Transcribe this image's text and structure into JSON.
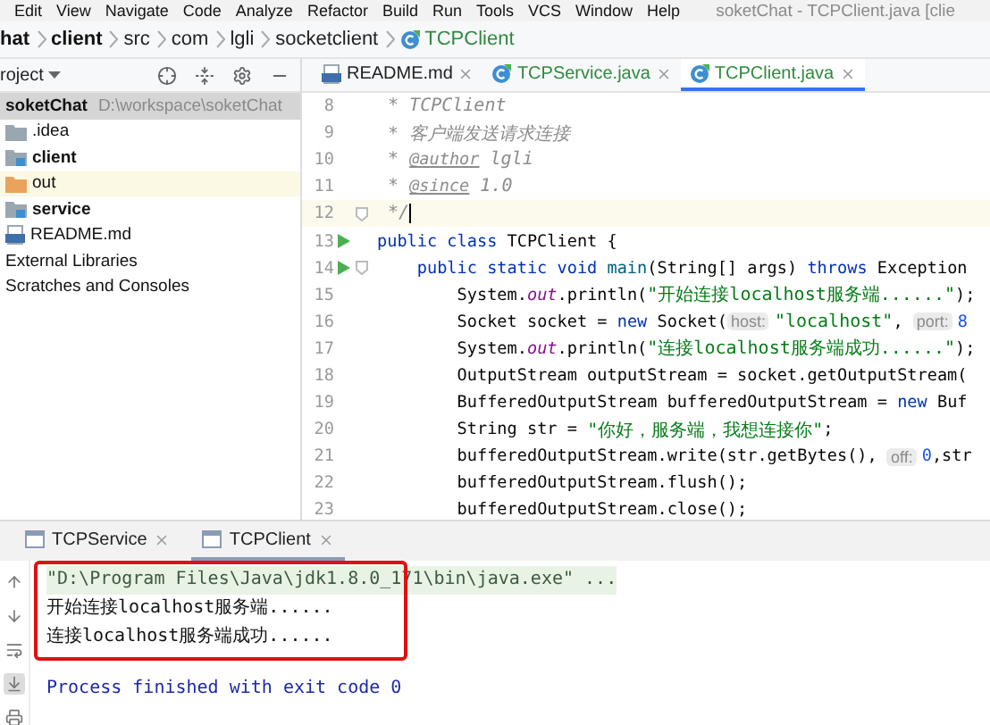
{
  "menu_bar": {
    "items": [
      "Edit",
      "View",
      "Navigate",
      "Code",
      "Analyze",
      "Refactor",
      "Build",
      "Run",
      "Tools",
      "VCS",
      "Window",
      "Help"
    ],
    "title": "soketChat - TCPClient.java [clie"
  },
  "breadcrumbs": [
    {
      "label": "hat",
      "kind": "module"
    },
    {
      "label": "client",
      "kind": "module"
    },
    {
      "label": "src",
      "kind": "folder"
    },
    {
      "label": "com",
      "kind": "folder"
    },
    {
      "label": "lgli",
      "kind": "folder"
    },
    {
      "label": "socketclient",
      "kind": "folder"
    },
    {
      "label": "TCPClient",
      "kind": "class"
    }
  ],
  "project_panel": {
    "title": "roject",
    "tree": [
      {
        "label": "soketChat",
        "path": "D:\\workspace\\soketChat",
        "kind": "project",
        "selected": true,
        "children": [
          {
            "label": ".idea",
            "kind": "folder",
            "selected": false
          },
          {
            "label": "client",
            "kind": "module",
            "selected": false
          },
          {
            "label": "out",
            "kind": "excluded",
            "selected": false
          },
          {
            "label": "service",
            "kind": "module",
            "selected": false
          },
          {
            "label": "README.md",
            "kind": "markdown",
            "selected": false
          }
        ]
      },
      {
        "label": "External Libraries",
        "kind": "library",
        "selected": false
      },
      {
        "label": "Scratches and Consoles",
        "kind": "scratches",
        "selected": false
      }
    ]
  },
  "editor": {
    "tabs": [
      {
        "label": "README.md",
        "kind": "markdown",
        "selected": false
      },
      {
        "label": "TCPService.java",
        "kind": "class",
        "selected": false
      },
      {
        "label": "TCPClient.java",
        "kind": "class",
        "selected": true
      }
    ],
    "lines": [
      {
        "number": "8",
        "run": false,
        "fold": false,
        "current": false,
        "tokens": [
          {
            "kind": "comment",
            "text": " * TCPClient"
          }
        ]
      },
      {
        "number": "9",
        "run": false,
        "fold": false,
        "current": false,
        "tokens": [
          {
            "kind": "comment",
            "text": " * 客户端发送请求连接"
          }
        ]
      },
      {
        "number": "10",
        "run": false,
        "fold": false,
        "current": false,
        "tokens": [
          {
            "kind": "comment",
            "text": " * "
          },
          {
            "kind": "doctag",
            "text": "@author"
          },
          {
            "kind": "comment",
            "text": " lgli"
          }
        ]
      },
      {
        "number": "11",
        "run": false,
        "fold": false,
        "current": false,
        "tokens": [
          {
            "kind": "comment",
            "text": " * "
          },
          {
            "kind": "doctag",
            "text": "@since"
          },
          {
            "kind": "comment",
            "text": " 1.0"
          }
        ]
      },
      {
        "number": "12",
        "run": false,
        "fold": true,
        "current": true,
        "tokens": [
          {
            "kind": "comment",
            "text": " */"
          }
        ]
      },
      {
        "number": "13",
        "run": true,
        "fold": false,
        "current": false,
        "tokens": [
          {
            "kind": "keyword",
            "text": "public class"
          },
          {
            "kind": "plain",
            "text": " TCPClient {"
          }
        ],
        "children": [
          {
            "number": "14",
            "run": true,
            "fold": true,
            "current": false,
            "tokens": [
              {
                "kind": "keyword",
                "text": "public static void"
              },
              {
                "kind": "method",
                "text": " main"
              },
              {
                "kind": "plain",
                "text": "(String[] args) "
              },
              {
                "kind": "keyword",
                "text": "throws"
              },
              {
                "kind": "plain",
                "text": " Exception"
              }
            ],
            "children": [
              {
                "number": "15",
                "run": false,
                "fold": false,
                "current": false,
                "tokens": [
                  {
                    "kind": "plain",
                    "text": "System."
                  },
                  {
                    "kind": "field",
                    "text": "out"
                  },
                  {
                    "kind": "plain",
                    "text": ".println("
                  },
                  {
                    "kind": "string",
                    "text": "\"开始连接localhost服务端......\""
                  },
                  {
                    "kind": "plain",
                    "text": ");"
                  }
                ]
              },
              {
                "number": "16",
                "run": false,
                "fold": false,
                "current": false,
                "tokens": [
                  {
                    "kind": "plain",
                    "text": "Socket socket = "
                  },
                  {
                    "kind": "keyword",
                    "text": "new"
                  },
                  {
                    "kind": "plain",
                    "text": " Socket("
                  },
                  {
                    "kind": "hint",
                    "text": "host:"
                  },
                  {
                    "kind": "string",
                    "text": "\"localhost\""
                  },
                  {
                    "kind": "plain",
                    "text": ", "
                  },
                  {
                    "kind": "hint",
                    "text": "port:"
                  },
                  {
                    "kind": "number",
                    "text": "8"
                  }
                ]
              },
              {
                "number": "17",
                "run": false,
                "fold": false,
                "current": false,
                "tokens": [
                  {
                    "kind": "plain",
                    "text": "System."
                  },
                  {
                    "kind": "field",
                    "text": "out"
                  },
                  {
                    "kind": "plain",
                    "text": ".println("
                  },
                  {
                    "kind": "string",
                    "text": "\"连接localhost服务端成功......\""
                  },
                  {
                    "kind": "plain",
                    "text": ");"
                  }
                ]
              },
              {
                "number": "18",
                "run": false,
                "fold": false,
                "current": false,
                "tokens": [
                  {
                    "kind": "plain",
                    "text": "OutputStream outputStream = socket.getOutputStream("
                  }
                ]
              },
              {
                "number": "19",
                "run": false,
                "fold": false,
                "current": false,
                "tokens": [
                  {
                    "kind": "plain",
                    "text": "BufferedOutputStream bufferedOutputStream = "
                  },
                  {
                    "kind": "keyword",
                    "text": "new"
                  },
                  {
                    "kind": "plain",
                    "text": " Buf"
                  }
                ]
              },
              {
                "number": "20",
                "run": false,
                "fold": false,
                "current": false,
                "tokens": [
                  {
                    "kind": "plain",
                    "text": "String str = "
                  },
                  {
                    "kind": "string",
                    "text": "\"你好，服务端，我想连接你\""
                  },
                  {
                    "kind": "plain",
                    "text": ";"
                  }
                ]
              },
              {
                "number": "21",
                "run": false,
                "fold": false,
                "current": false,
                "tokens": [
                  {
                    "kind": "plain",
                    "text": "bufferedOutputStream.write(str.getBytes(), "
                  },
                  {
                    "kind": "hint",
                    "text": "off:"
                  },
                  {
                    "kind": "number",
                    "text": "0"
                  },
                  {
                    "kind": "plain",
                    "text": ",str"
                  }
                ]
              },
              {
                "number": "22",
                "run": false,
                "fold": false,
                "current": false,
                "tokens": [
                  {
                    "kind": "plain",
                    "text": "bufferedOutputStream.flush();"
                  }
                ]
              },
              {
                "number": "23",
                "run": false,
                "fold": false,
                "current": false,
                "tokens": [
                  {
                    "kind": "plain",
                    "text": "bufferedOutputStream.close();"
                  }
                ]
              }
            ]
          }
        ]
      }
    ]
  },
  "run_panel": {
    "tabs": [
      {
        "label": "TCPService",
        "selected": false
      },
      {
        "label": "TCPClient",
        "selected": true
      }
    ],
    "console": [
      {
        "kind": "command",
        "text": "\"D:\\Program Files\\Java\\jdk1.8.0_171\\bin\\java.exe\" ..."
      },
      {
        "kind": "output",
        "text": "开始连接localhost服务端......"
      },
      {
        "kind": "output",
        "text": "连接localhost服务端成功......"
      },
      {
        "kind": "exit",
        "text": "Process finished with exit code 0"
      }
    ]
  }
}
